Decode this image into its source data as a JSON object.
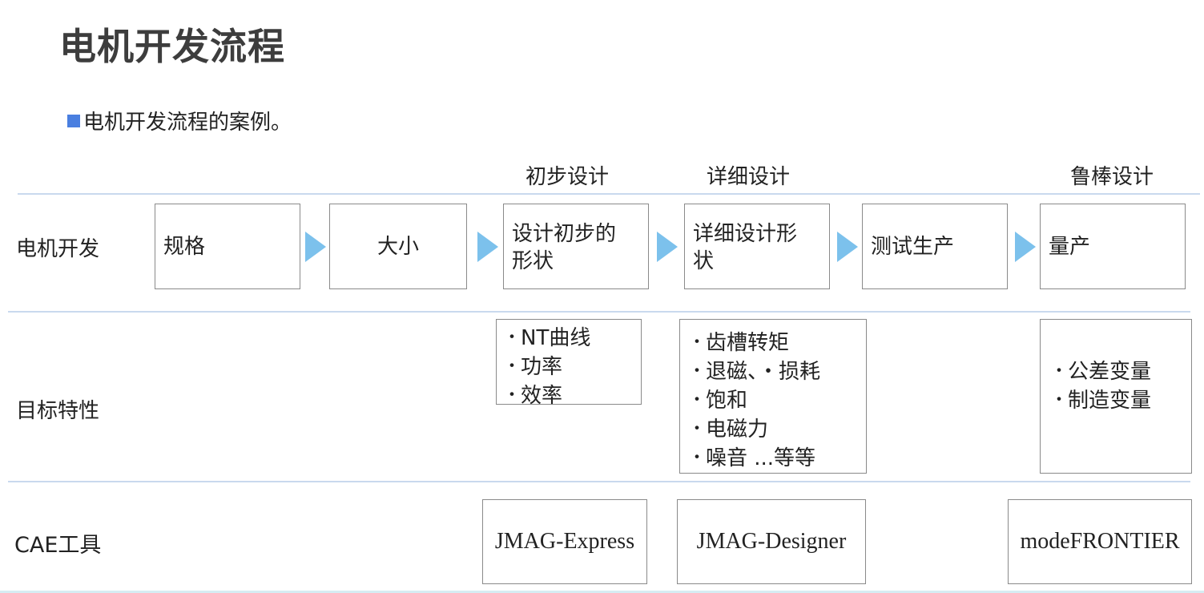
{
  "title": "电机开发流程",
  "bullet": "电机开发流程的案例。",
  "phases": [
    "初步设计",
    "详细设计",
    "鲁棒设计"
  ],
  "rows": {
    "motor_dev": "电机开发",
    "target": "目标特性",
    "cae": "CAE工具"
  },
  "steps": [
    "规格",
    "大小",
    "设计初步的形状",
    "详细设计形状",
    "测试生产",
    "量产"
  ],
  "steps_lines": [
    [
      "规格"
    ],
    [
      "大小"
    ],
    [
      "设计初步的",
      "形状"
    ],
    [
      "详细设计形",
      "状"
    ],
    [
      "测试生产"
    ],
    [
      "量产"
    ]
  ],
  "targets": {
    "preliminary": [
      "NT曲线",
      "功率",
      "效率"
    ],
    "detailed": [
      "齿槽转矩",
      "退磁、・损耗",
      "饱和",
      "电磁力",
      "噪音 ...等等"
    ],
    "robust": [
      "公差变量",
      "制造变量"
    ]
  },
  "tools": [
    "JMAG-Express",
    "JMAG-Designer",
    "modeFRONTIER"
  ],
  "colors": {
    "accent": "#4a7fe0",
    "arrow": "#7cc1ec",
    "rule": "#c9d9ee",
    "border": "#8a8a8a"
  }
}
